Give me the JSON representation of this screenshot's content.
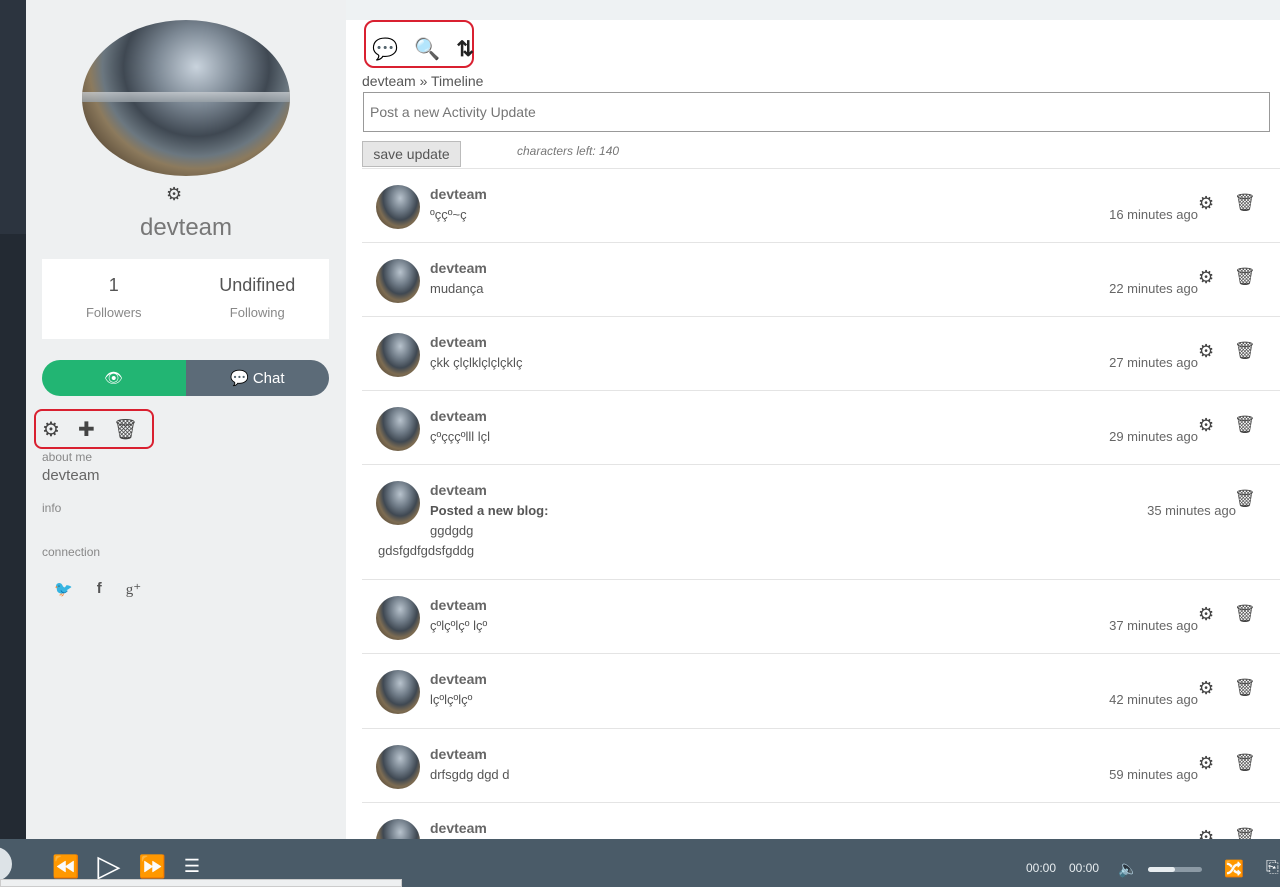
{
  "sidebar": {
    "name": "devteam",
    "stats": [
      {
        "num": "1",
        "label": "Followers"
      },
      {
        "num": "Undifined",
        "label": "Following"
      }
    ],
    "chat_label": "Chat",
    "about_label": "about me",
    "about_value": "devteam",
    "info_label": "info",
    "connection_label": "connection",
    "social": [
      "twitter-icon",
      "facebook-icon",
      "google-plus-icon"
    ]
  },
  "main": {
    "breadcrumb": "devteam » Timeline",
    "post_placeholder": "Post a new Activity Update",
    "save_label": "save update",
    "chars_left": "characters left: 140"
  },
  "feed": [
    {
      "name": "devteam",
      "text": "ºççº~ç",
      "time": "16 minutes ago",
      "type": "status"
    },
    {
      "name": "devteam",
      "text": "mudança",
      "time": "22 minutes ago",
      "type": "status"
    },
    {
      "name": "devteam",
      "text": "çkk çlçlklçlçlçklç",
      "time": "27 minutes ago",
      "type": "status"
    },
    {
      "name": "devteam",
      "text": "çºçççºlll lçl",
      "time": "29 minutes ago",
      "type": "status"
    },
    {
      "name": "devteam",
      "label": "Posted a new blog:",
      "title": "ggdgdg",
      "body": "gdsfgdfgdsfgddg",
      "time": "35 minutes ago",
      "type": "blog"
    },
    {
      "name": "devteam",
      "text": "çºlçºlçº lçº",
      "time": "37 minutes ago",
      "type": "status"
    },
    {
      "name": "devteam",
      "text": "lçºlçºlçº",
      "time": "42 minutes ago",
      "type": "status"
    },
    {
      "name": "devteam",
      "text": "drfsgdg dgd d",
      "time": "59 minutes ago",
      "type": "status"
    },
    {
      "name": "devteam",
      "type": "partial"
    }
  ],
  "player": {
    "time_current": "00:00",
    "time_total": "00:00",
    "volume_fraction": 0.5
  }
}
